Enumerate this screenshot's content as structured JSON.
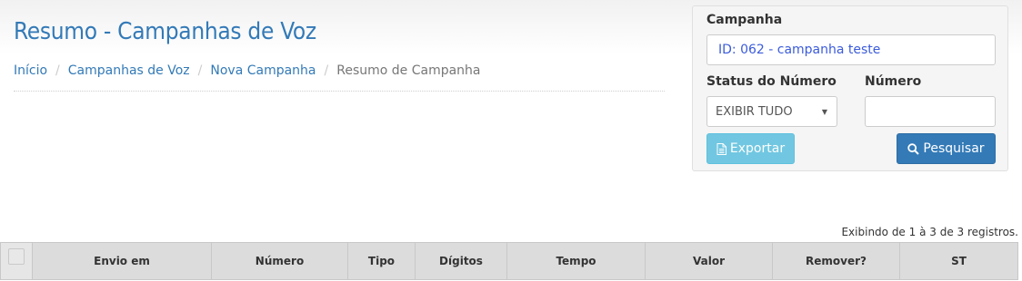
{
  "header": {
    "title": "Resumo - Campanhas de Voz",
    "breadcrumb": [
      "Início",
      "Campanhas de Voz",
      "Nova Campanha",
      "Resumo de Campanha"
    ]
  },
  "filter": {
    "campaign_label": "Campanha",
    "campaign_value": "ID: 062 - campanha teste",
    "status_label": "Status do Número",
    "status_value": "EXIBIR TUDO",
    "number_label": "Número",
    "number_value": "",
    "export_label": "Exportar",
    "search_label": "Pesquisar"
  },
  "table": {
    "info": "Exibindo de 1 à 3 de 3 registros.",
    "columns": [
      "Envio em",
      "Número",
      "Tipo",
      "Dígitos",
      "Tempo",
      "Valor",
      "Remover?",
      "ST"
    ]
  },
  "colors": {
    "primary": "#337ab7",
    "info": "#5bc0de",
    "header_bg": "#dcdcdc"
  },
  "icons": {
    "export": "file-text-icon",
    "search": "search-icon"
  }
}
